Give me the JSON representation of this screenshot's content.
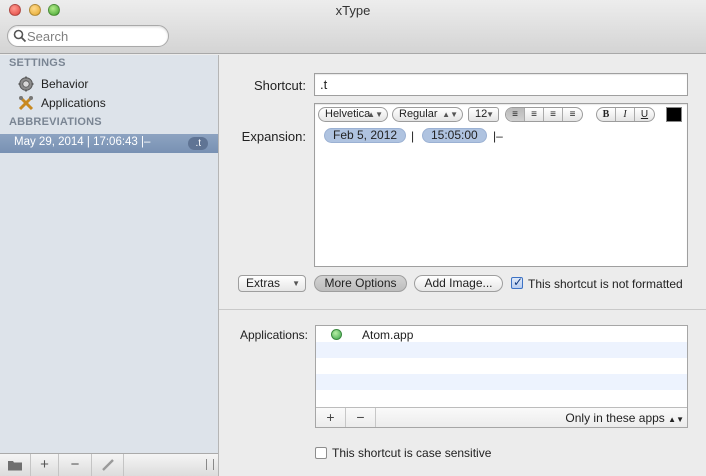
{
  "window": {
    "title": "xType"
  },
  "search": {
    "placeholder": "Search"
  },
  "sidebar": {
    "settings_header": "SETTINGS",
    "settings_items": [
      {
        "label": "Behavior",
        "icon": "gear-icon"
      },
      {
        "label": "Applications",
        "icon": "tools-icon"
      }
    ],
    "abbreviations_header": "ABBREVIATIONS",
    "abbreviations": [
      {
        "label": "May 29, 2014 | 17:06:43 |–",
        "badge": ".t",
        "selected": true
      }
    ],
    "bottom_buttons": [
      "folder-icon",
      "+",
      "−",
      "pencil-icon",
      "resize-grip-icon"
    ]
  },
  "editor": {
    "shortcut_label": "Shortcut:",
    "shortcut_value": ".t",
    "expansion_label": "Expansion:",
    "toolbar": {
      "font": "Helvetica",
      "style": "Regular",
      "size": "12",
      "align_options": [
        "left",
        "center",
        "right",
        "justify"
      ],
      "format_options": [
        "B",
        "I",
        "U"
      ],
      "text_color": "#000000"
    },
    "expansion_tokens": [
      {
        "type": "token",
        "text": "Feb 5, 2012"
      },
      {
        "type": "text",
        "text": "|"
      },
      {
        "type": "token",
        "text": "15:05:00"
      },
      {
        "type": "text",
        "text": "|–"
      }
    ],
    "extras_label": "Extras",
    "more_options_label": "More Options",
    "add_image_label": "Add Image...",
    "not_formatted_label": "This shortcut is not formatted",
    "not_formatted_checked": true
  },
  "applications": {
    "label": "Applications:",
    "apps": [
      {
        "name": "Atom.app"
      }
    ],
    "add_label": "+",
    "remove_label": "−",
    "scope_value": "Only in these apps",
    "case_sensitive_label": "This shortcut is case sensitive",
    "case_sensitive_checked": false
  },
  "colors": {
    "selection": "#7f96b8",
    "token": "#afc3e0",
    "sidebar_bg": "#dde3ea"
  }
}
